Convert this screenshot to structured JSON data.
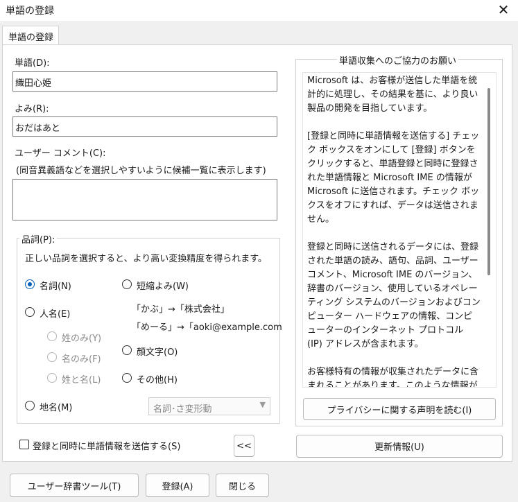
{
  "window": {
    "title": "単語の登録"
  },
  "tabs": [
    {
      "label": "単語の登録"
    }
  ],
  "form": {
    "word_label": "単語(D):",
    "word_value": "織田心姫",
    "reading_label": "よみ(R):",
    "reading_value": "おだはあと",
    "comment_label": "ユーザー コメント(C):",
    "comment_hint": "(同音異義語などを選択しやすいように候補一覧に表示します)",
    "comment_value": ""
  },
  "pos": {
    "group_title": "品詞(P):",
    "description": "正しい品詞を選択すると、より高い変換精度を得られます。",
    "options": {
      "noun": "名詞(N)",
      "abbrev": "短縮よみ(W)",
      "abbrev_example1": "「かぶ」→「株式会社」",
      "abbrev_example2": "「めーる」→「aoki@example.com",
      "person": "人名(E)",
      "surname": "姓のみ(Y)",
      "given": "名のみ(F)",
      "fullname": "姓と名(L)",
      "emoticon": "顔文字(O)",
      "other": "その他(H)",
      "place": "地名(M)"
    },
    "selected": "noun",
    "select_value": "名詞･さ変形動"
  },
  "send_checkbox_label": "登録と同時に単語情報を送信する(S)",
  "collapse_button": "<<",
  "info": {
    "group_title": "単語収集へのご協力のお願い",
    "paragraphs": [
      "Microsoft は、お客様が送信した単語を統計的に処理し、その結果を基に、より良い製品の開発を目指しています。",
      "[登録と同時に単語情報を送信する] チェック ボックスをオンにして [登録] ボタンをクリックすると、単語登録と同時に登録された単語情報と Microsoft IME の情報が Microsoft に送信されます。チェック ボックスをオフにすれば、データは送信されません。",
      "登録と同時に送信されるデータには、登録された単語の読み、語句、品詞、ユーザー コメント、Microsoft IME のバージョン、辞書のバージョン、使用しているオペレーティング システムのバージョンおよびコンピューター ハードウェアの情報、コンピューターのインターネット プロトコル (IP) アドレスが含まれます。",
      "お客様特有の情報が収集されたデータに含まれることがあります。このような情報が"
    ],
    "privacy_button": "プライバシーに関する声明を読む(I)",
    "update_button": "更新情報(U)"
  },
  "footer": {
    "dict_tool_button": "ユーザー辞書ツール(T)",
    "register_button": "登録(A)",
    "close_button": "閉じる"
  }
}
